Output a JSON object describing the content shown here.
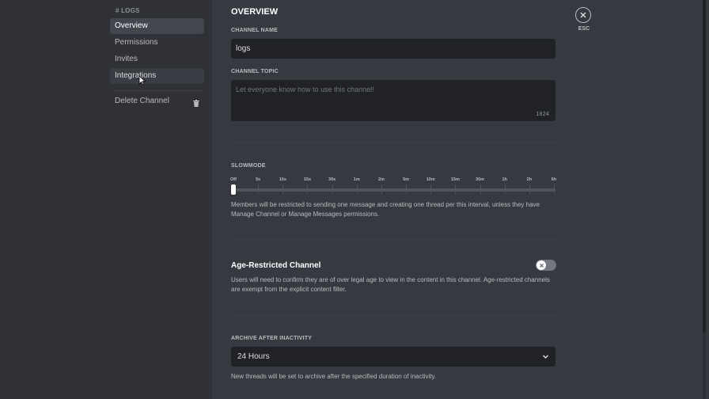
{
  "sidebar": {
    "header": "# LOGS",
    "items": [
      {
        "label": "Overview"
      },
      {
        "label": "Permissions"
      },
      {
        "label": "Invites"
      },
      {
        "label": "Integrations"
      }
    ],
    "delete_label": "Delete Channel"
  },
  "main": {
    "title": "OVERVIEW",
    "channel_name": {
      "label": "CHANNEL NAME",
      "value": "logs"
    },
    "channel_topic": {
      "label": "CHANNEL TOPIC",
      "placeholder": "Let everyone know how to use this channel!",
      "counter": "1024"
    },
    "slowmode": {
      "label": "SLOWMODE",
      "ticks": [
        "Off",
        "5s",
        "10s",
        "15s",
        "30s",
        "1m",
        "2m",
        "5m",
        "10m",
        "15m",
        "30m",
        "1h",
        "2h",
        "6h"
      ],
      "selected": "Off",
      "help": "Members will be restricted to sending one message and creating one thread per this interval, unless they have Manage Channel or Manage Messages permissions."
    },
    "age_restricted": {
      "title": "Age-Restricted Channel",
      "enabled": false,
      "help": "Users will need to confirm they are of over legal age to view in the content in this channel. Age-restricted channels are exempt from the explicit content filter."
    },
    "archive": {
      "label": "ARCHIVE AFTER INACTIVITY",
      "value": "24 Hours",
      "help": "New threads will be set to archive after the specified duration of inactivity."
    }
  },
  "close": {
    "label": "ESC"
  },
  "colors": {
    "background": "#36393f",
    "sidebar": "#2f3136",
    "input": "#202225",
    "selected": "#42464d"
  }
}
